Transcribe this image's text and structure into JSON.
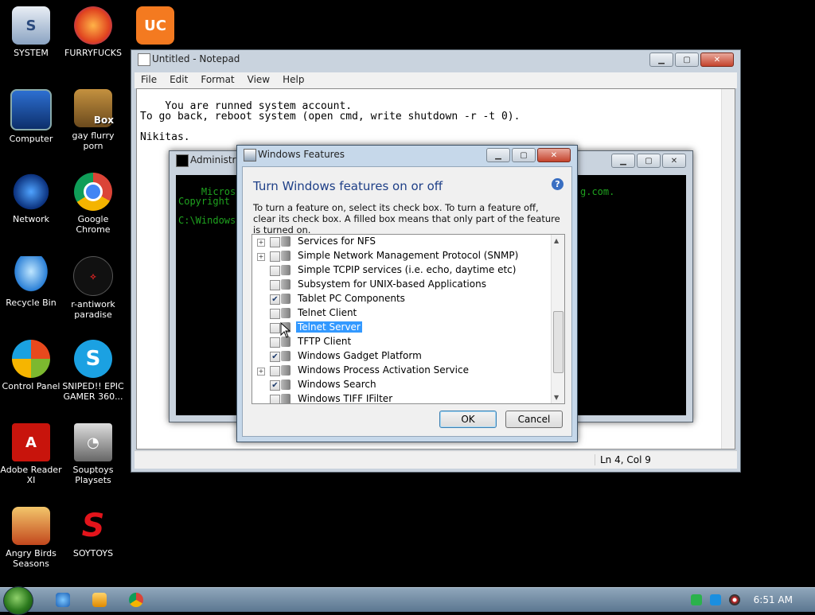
{
  "desktop": {
    "icons": [
      {
        "label": "SYSTEM"
      },
      {
        "label": "FURRYFUCKS"
      },
      {
        "label": ""
      },
      {
        "label": "Computer"
      },
      {
        "label": "gay flurry porn"
      },
      {
        "label": "Network"
      },
      {
        "label": "Google Chrome"
      },
      {
        "label": "Recycle Bin"
      },
      {
        "label": "r-antiwork paradise"
      },
      {
        "label": "Control Panel"
      },
      {
        "label": "SNIPED!! EPIC GAMER 360..."
      },
      {
        "label": "Adobe Reader XI"
      },
      {
        "label": "Souptoys Playsets"
      },
      {
        "label": "Angry Birds Seasons"
      },
      {
        "label": "SOYTOYS"
      }
    ],
    "box_badge": "Box"
  },
  "notepad": {
    "title": "Untitled - Notepad",
    "menu": [
      "File",
      "Edit",
      "Format",
      "View",
      "Help"
    ],
    "text": "You are runned system account.\nTo go back, reboot system (open cmd, write shutdown -r -t 0).\n\nNikitas.",
    "status_position": "Ln 4, Col 9"
  },
  "cmd": {
    "title": "Administra",
    "text": "Microsoft\nCopyright\n\nC:\\Windows",
    "text_right": "g.com."
  },
  "features": {
    "title": "Windows Features",
    "heading": "Turn Windows features on or off",
    "help": "?",
    "description": "To turn a feature on, select its check box. To turn a feature off, clear its check box. A filled box means that only part of the feature is turned on.",
    "items": [
      {
        "label": "Services for NFS",
        "checked": false,
        "expandable": true,
        "selected": false
      },
      {
        "label": "Simple Network Management Protocol (SNMP)",
        "checked": false,
        "expandable": true,
        "selected": false
      },
      {
        "label": "Simple TCPIP services (i.e. echo, daytime etc)",
        "checked": false,
        "expandable": false,
        "selected": false
      },
      {
        "label": "Subsystem for UNIX-based Applications",
        "checked": false,
        "expandable": false,
        "selected": false
      },
      {
        "label": "Tablet PC Components",
        "checked": true,
        "expandable": false,
        "selected": false
      },
      {
        "label": "Telnet Client",
        "checked": false,
        "expandable": false,
        "selected": false
      },
      {
        "label": "Telnet Server",
        "checked": false,
        "expandable": false,
        "selected": true
      },
      {
        "label": "TFTP Client",
        "checked": false,
        "expandable": false,
        "selected": false
      },
      {
        "label": "Windows Gadget Platform",
        "checked": true,
        "expandable": false,
        "selected": false
      },
      {
        "label": "Windows Process Activation Service",
        "checked": false,
        "expandable": true,
        "selected": false
      },
      {
        "label": "Windows Search",
        "checked": true,
        "expandable": false,
        "selected": false
      },
      {
        "label": "Windows TIFF IFilter",
        "checked": false,
        "expandable": false,
        "selected": false
      }
    ],
    "ok_label": "OK",
    "cancel_label": "Cancel"
  },
  "taskbar": {
    "clock": "6:51 AM",
    "pinned": [
      "internet-explorer-icon",
      "media-player-icon",
      "chrome-icon"
    ]
  }
}
